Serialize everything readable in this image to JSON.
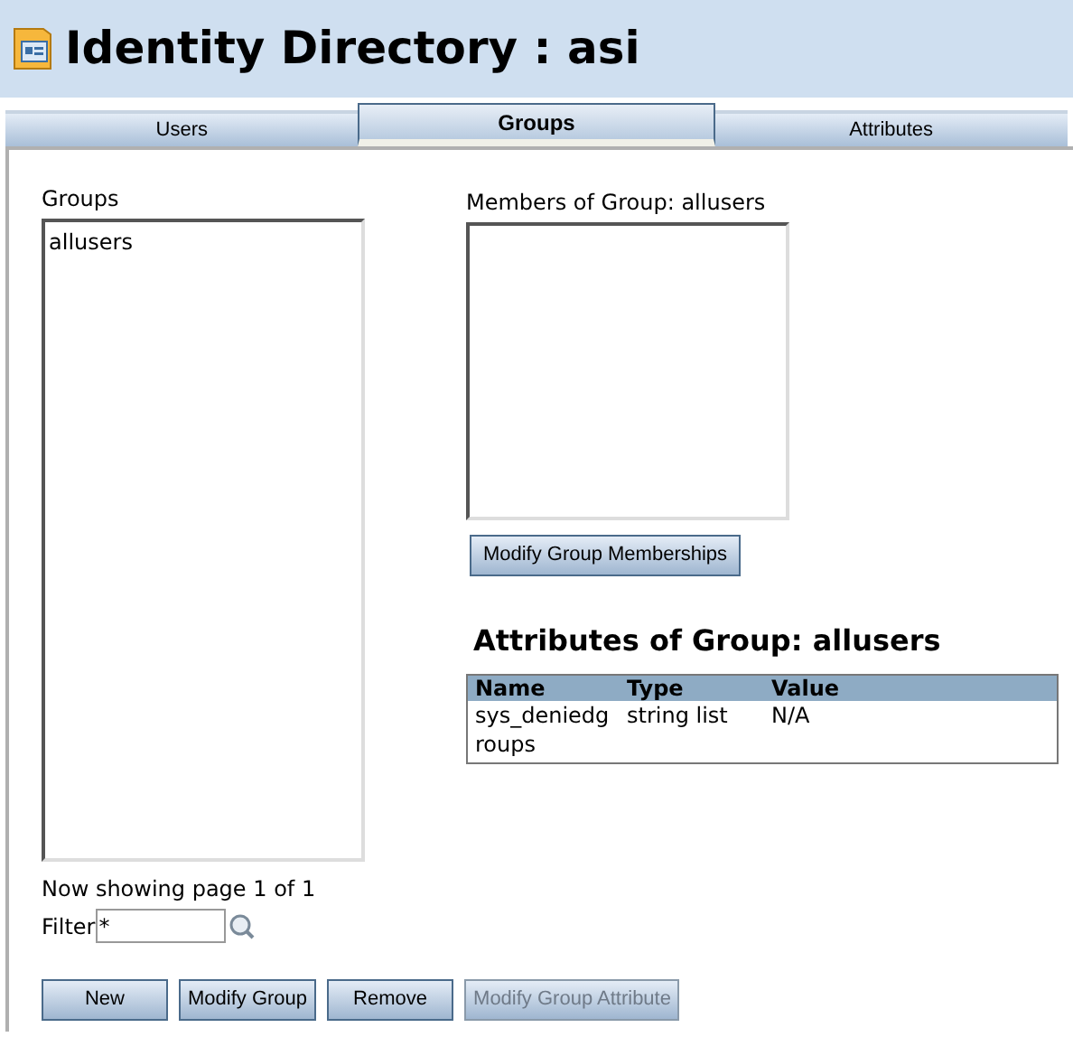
{
  "window": {
    "title": "Identity Directory : asi"
  },
  "tabs": [
    {
      "label": "Users",
      "selected": false
    },
    {
      "label": "Groups",
      "selected": true
    },
    {
      "label": "Attributes",
      "selected": false
    }
  ],
  "groups": {
    "label": "Groups",
    "items": [
      {
        "label": "allusers",
        "selected": false
      }
    ]
  },
  "paging": "Now showing page 1 of 1",
  "filter": {
    "label": "Filter",
    "value": "*"
  },
  "members": {
    "label": "Members of Group: allusers",
    "button": "Modify Group Memberships"
  },
  "attributes": {
    "title": "Attributes of Group: allusers",
    "columns": [
      "Name",
      "Type",
      "Value"
    ],
    "rows": [
      [
        "sys_deniedg roups",
        "string list",
        "N/A"
      ]
    ]
  },
  "buttons": [
    {
      "label": "New",
      "disabled": false
    },
    {
      "label": "Modify Group",
      "disabled": false
    },
    {
      "label": "Remove",
      "disabled": false
    },
    {
      "label": "Modify Group Attribute",
      "disabled": true
    }
  ]
}
